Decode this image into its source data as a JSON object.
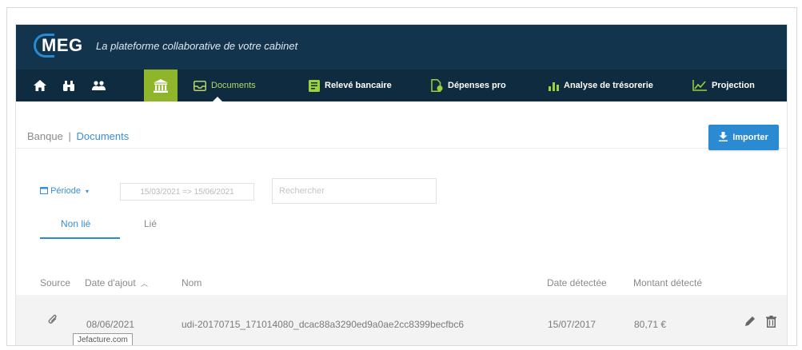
{
  "header": {
    "logo_text": "MEG",
    "tagline": "La plateforme collaborative de votre cabinet"
  },
  "nav": {
    "icons": [
      "home-icon",
      "binoculars-icon",
      "users-icon",
      "bank-icon"
    ],
    "items": [
      {
        "label": "Documents",
        "icon": "inbox-icon",
        "active": true
      },
      {
        "label": "Relevé bancaire",
        "icon": "statement-icon",
        "active": false
      },
      {
        "label": "Dépenses pro",
        "icon": "expenses-icon",
        "active": false
      },
      {
        "label": "Analyse de trésorerie",
        "icon": "bar-chart-icon",
        "active": false
      },
      {
        "label": "Projection",
        "icon": "line-chart-icon",
        "active": false
      }
    ],
    "active_color": "#8fb62b"
  },
  "breadcrumb": {
    "root": "Banque",
    "separator": "|",
    "current": "Documents"
  },
  "import_button": {
    "label": "Importer",
    "color": "#2a8bd2"
  },
  "filters": {
    "period_label": "Période",
    "date_range": "15/03/2021 => 15/06/2021",
    "search_placeholder": "Rechercher"
  },
  "tabs": [
    {
      "label": "Non lié",
      "active": true
    },
    {
      "label": "Lié",
      "active": false
    }
  ],
  "table": {
    "columns": [
      "Source",
      "Date d'ajout",
      "Nom",
      "Date détectée",
      "Montant détecté"
    ],
    "sort_column": "Date d'ajout",
    "sort_direction": "asc",
    "rows": [
      {
        "source_icon": "paperclip-icon",
        "date_added": "08/06/2021",
        "name": "udi-20170715_171014080_dcac88a3290ed9a0ae2cc8399becfbc6",
        "date_detected": "15/07/2017",
        "amount": "80,71 €"
      }
    ]
  },
  "tooltip": {
    "text": "Jefacture.com"
  },
  "colors": {
    "topbar": "#12344d",
    "navbar": "#0f2b40",
    "link": "#3b8fd4",
    "accent_green": "#8fb62b"
  }
}
